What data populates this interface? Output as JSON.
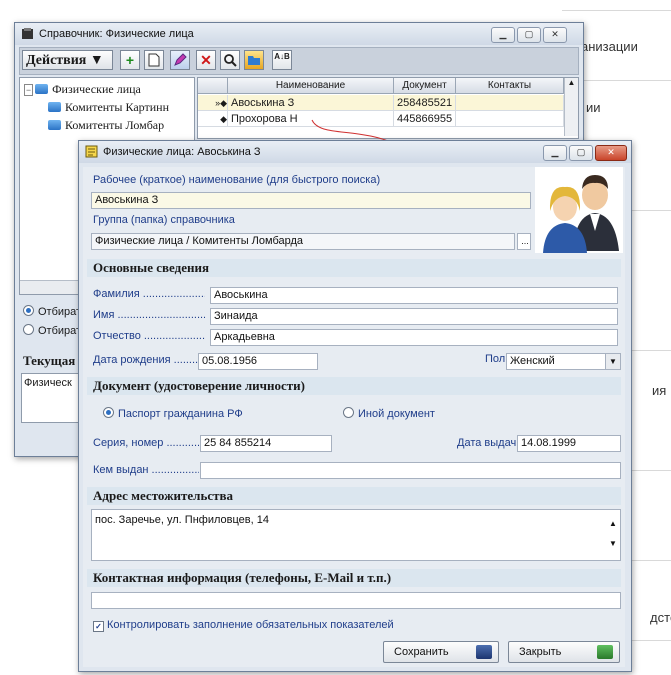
{
  "background": {
    "fragments": [
      "анизации",
      "ии",
      "ия",
      "дстe"
    ]
  },
  "main_window": {
    "title": "Справочник: Физические лица",
    "toolbar": {
      "actions_label": "Действия ▼",
      "add_label": "+",
      "delete_label": "✕",
      "search_label": "🔍",
      "sort_label": "A↓B"
    },
    "tree": {
      "root": "Физические лица",
      "children": [
        "Комитенты Картинн",
        "Комитенты Ломбар"
      ]
    },
    "grid": {
      "columns": [
        "Наименование",
        "Документ",
        "Контакты"
      ],
      "rows": [
        {
          "name": "Авоськина З",
          "document": "258485521",
          "contacts": ""
        },
        {
          "name": "Прохорова Н",
          "document": "445866955",
          "contacts": ""
        }
      ]
    },
    "filters": [
      "Отбират",
      "Отбират"
    ],
    "current_label": "Текущая",
    "current_value": "Физическ"
  },
  "dialog": {
    "title": "Физические лица: Авоськина З",
    "short_name_label": "Рабочее (краткое) наименование (для быстрого поиска)",
    "short_name_value": "Авоськина З",
    "group_label": "Группа (папка) справочника",
    "group_value": "Физические лица / Комитенты Ломбарда",
    "group_button": "...",
    "sections": {
      "basic": "Основные сведения",
      "document": "Документ (удостоверение личности)",
      "address": "Адрес местожительства",
      "contacts": "Контактная информация (телефоны, E-Mail и т.п.)"
    },
    "surname_label": "Фамилия ..........................",
    "surname_value": "Авоськина",
    "name_label": "Имя ...................................",
    "name_value": "Зинаида",
    "patronymic_label": "Отчество ..........................",
    "patronymic_value": "Аркадьевна",
    "birth_label": "Дата рождения ............",
    "birth_value": "05.08.1956",
    "gender_label": "Пол",
    "gender_value": "Женский",
    "doc_radio_1": "Паспорт гражданина РФ",
    "doc_radio_2": "Иной документ",
    "series_label": "Серия, номер .................",
    "series_value": "25 84 855214",
    "issue_date_label": "Дата выдачи",
    "issue_date_value": "14.08.1999",
    "issued_by_label": "Кем выдан .......................",
    "issued_by_value": "",
    "address_value": "пос. Заречье, ул. Пнфиловцев, 14",
    "contacts_value": "",
    "control_check": "Контролировать заполнение обязательных показателей",
    "save_button": "Сохранить",
    "close_button": "Закрыть"
  },
  "colors": {
    "window_bg": "#dfe6ef",
    "section_bg": "#dbe6ef",
    "label_blue": "#1f3d8a",
    "selected_row": "#fbf6d7"
  }
}
